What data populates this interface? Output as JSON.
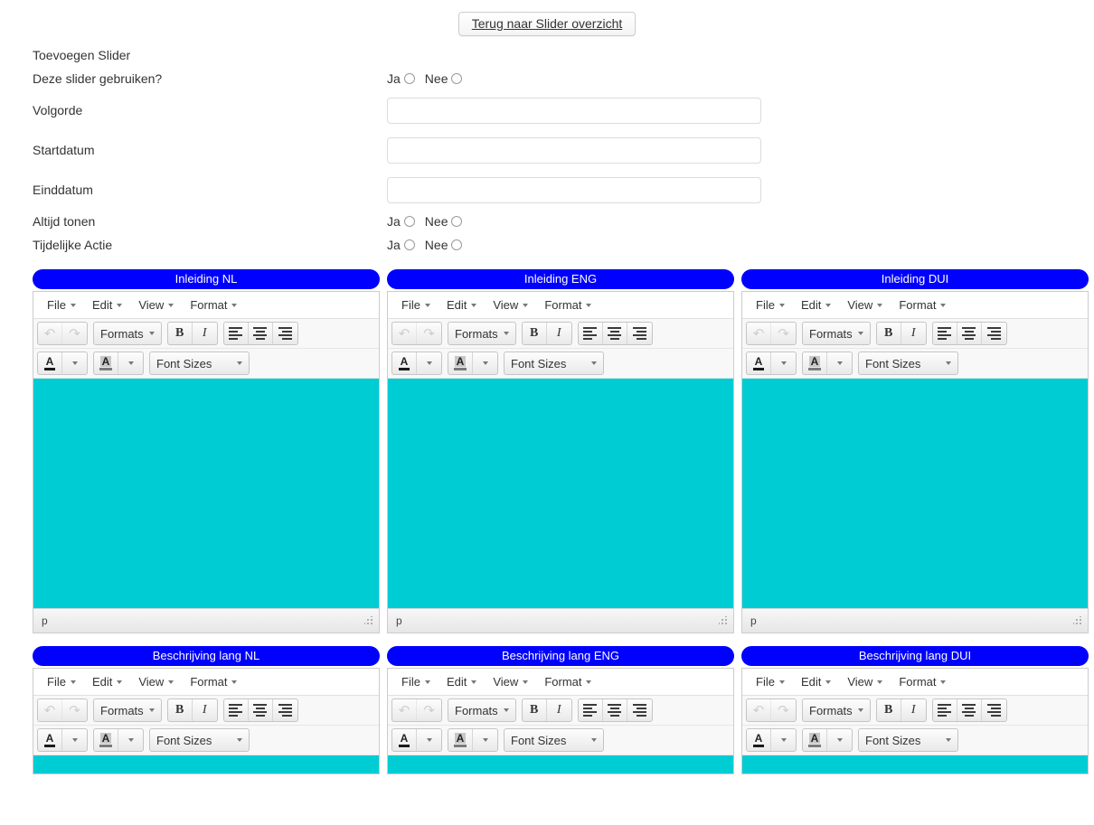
{
  "topbar": {
    "back_button_label": "Terug naar Slider overzicht"
  },
  "form": {
    "heading": "Toevoegen Slider",
    "rows": [
      {
        "label": "Deze slider gebruiken?",
        "type": "radio",
        "yes": "Ja",
        "no": "Nee",
        "selected": ""
      },
      {
        "label": "Volgorde",
        "type": "text",
        "value": "",
        "placeholder": ""
      },
      {
        "label": "Startdatum",
        "type": "text",
        "value": "",
        "placeholder": ""
      },
      {
        "label": "Einddatum",
        "type": "text",
        "value": "",
        "placeholder": ""
      },
      {
        "label": "Altijd tonen",
        "type": "radio",
        "yes": "Ja",
        "no": "Nee",
        "selected": ""
      },
      {
        "label": "Tijdelijke Actie",
        "type": "radio",
        "yes": "Ja",
        "no": "Nee",
        "selected": ""
      }
    ]
  },
  "editor_common": {
    "menubar": [
      "File",
      "Edit",
      "View",
      "Format"
    ],
    "toolbar": {
      "undo_label": "↶",
      "redo_label": "↷",
      "formats_label": "Formats",
      "bold_label": "B",
      "italic_label": "I",
      "align_left_name": "align-left",
      "align_center_name": "align-center",
      "align_right_name": "align-right",
      "forecolor_label": "A",
      "backcolor_label": "A",
      "fontsizes_label": "Font Sizes"
    },
    "statusbar_path": "p",
    "body_color": "#00ccd4",
    "title_bar_color": "#0000ff"
  },
  "editor_rows": [
    {
      "editors": [
        {
          "title": "Inleiding NL",
          "content": ""
        },
        {
          "title": "Inleiding ENG",
          "content": ""
        },
        {
          "title": "Inleiding DUI",
          "content": ""
        }
      ]
    },
    {
      "editors": [
        {
          "title": "Beschrijving lang NL",
          "content": ""
        },
        {
          "title": "Beschrijving lang ENG",
          "content": ""
        },
        {
          "title": "Beschrijving lang DUI",
          "content": ""
        }
      ]
    }
  ]
}
